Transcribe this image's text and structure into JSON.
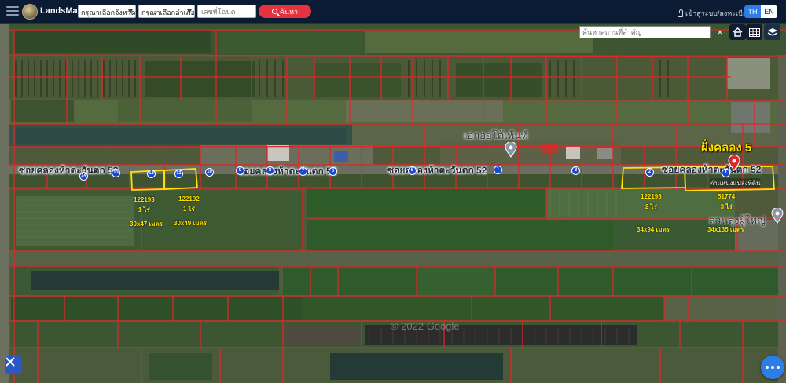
{
  "header": {
    "app_name": "LandsMaps",
    "province_select": "กรุณาเลือกจังหวัด",
    "district_select": "กรุณาเลือกอำเภอ",
    "deed_placeholder": "เลขที่โฉนด",
    "search_label": "ค้นหา",
    "login_label": "เข้าสู่ระบบ/ลงทะเบียน",
    "lang_th": "TH",
    "lang_en": "EN"
  },
  "map": {
    "place_search_placeholder": "ค้นหาสถานที่สำคัญ",
    "clear_symbol": "×",
    "street_labels": [
      "ซอยคลองห้าตะวันตก 52",
      "ซอยคลองห้าตะวันตก 52",
      "ซอยคลองห้าตะวันตก 52",
      "ซอยคลองห้าตะวันตก 52"
    ],
    "poi_1": "เอกออโต้เพ้นท์",
    "poi_2": "สวนลุงผู้ใหญ่",
    "annotation_title": "ฝั่งคลอง 5",
    "annotation_sub": "ตำแหน่งแปลงที่ดิน",
    "watermark": "© 2022 Google",
    "plots": [
      {
        "deed": "122193",
        "area": "1 ไร่",
        "size": "30x47 เมตร"
      },
      {
        "deed": "122192",
        "area": "1 ไร่",
        "size": "30x49 เมตร"
      },
      {
        "deed": "122198",
        "area": "2 ไร่",
        "size": "34x94 เมตร"
      },
      {
        "deed": "51774",
        "area": "3 ไร่",
        "size": "34x135 เมตร"
      }
    ],
    "markers": [
      "14",
      "13",
      "12",
      "11",
      "10",
      "9",
      "8",
      "7",
      "6",
      "5",
      "1",
      "3",
      "2",
      "1"
    ]
  },
  "colors": {
    "topbar": "#0b1b33",
    "search_button": "#e5333f",
    "parcel_lines": "#e0262b",
    "highlight": "#ffe100",
    "marker": "#1848d0",
    "accent": "#2a7ee6"
  },
  "icons": {
    "menu": "hamburger-icon",
    "home": "home-icon",
    "grid": "grid-icon",
    "layers": "layers-icon",
    "tools": "tools-icon",
    "chat": "chat-dots-icon",
    "pin": "location-pin-icon"
  }
}
